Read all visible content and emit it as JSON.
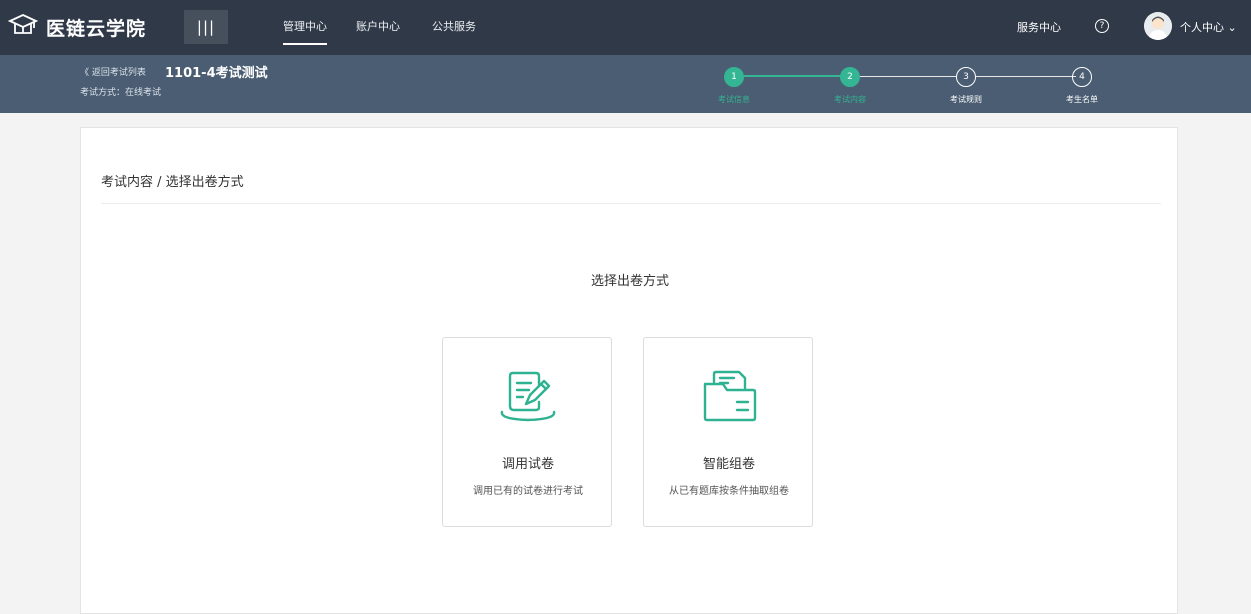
{
  "topbar": {
    "logo_text": "医链云学院",
    "menu_toggle": "|||",
    "nav": [
      "管理中心",
      "账户中心",
      "公共服务"
    ],
    "service_center": "服务中心",
    "help": "?",
    "user_center": "个人中心 ⌄"
  },
  "subbar": {
    "back_label": "《 返回考试列表",
    "exam_title": "1101-4考试测试",
    "exam_mode": "考试方式：在线考试",
    "steps": [
      {
        "num": "1",
        "label": "考试信息",
        "status": "done"
      },
      {
        "num": "2",
        "label": "考试内容",
        "status": "current"
      },
      {
        "num": "3",
        "label": "考试规则",
        "status": "todo"
      },
      {
        "num": "4",
        "label": "考生名单",
        "status": "todo"
      }
    ]
  },
  "main": {
    "breadcrumb": "考试内容 / 选择出卷方式",
    "section_title": "选择出卷方式",
    "options": [
      {
        "name": "调用试卷",
        "desc": "调用已有的试卷进行考试",
        "icon": "edit-paper-icon"
      },
      {
        "name": "智能组卷",
        "desc": "从已有题库按条件抽取组卷",
        "icon": "folder-document-icon"
      }
    ]
  },
  "colors": {
    "topbar": "#2f3948",
    "subbar": "#4a5d72",
    "accent": "#34b593",
    "background": "#f3f3f3"
  }
}
